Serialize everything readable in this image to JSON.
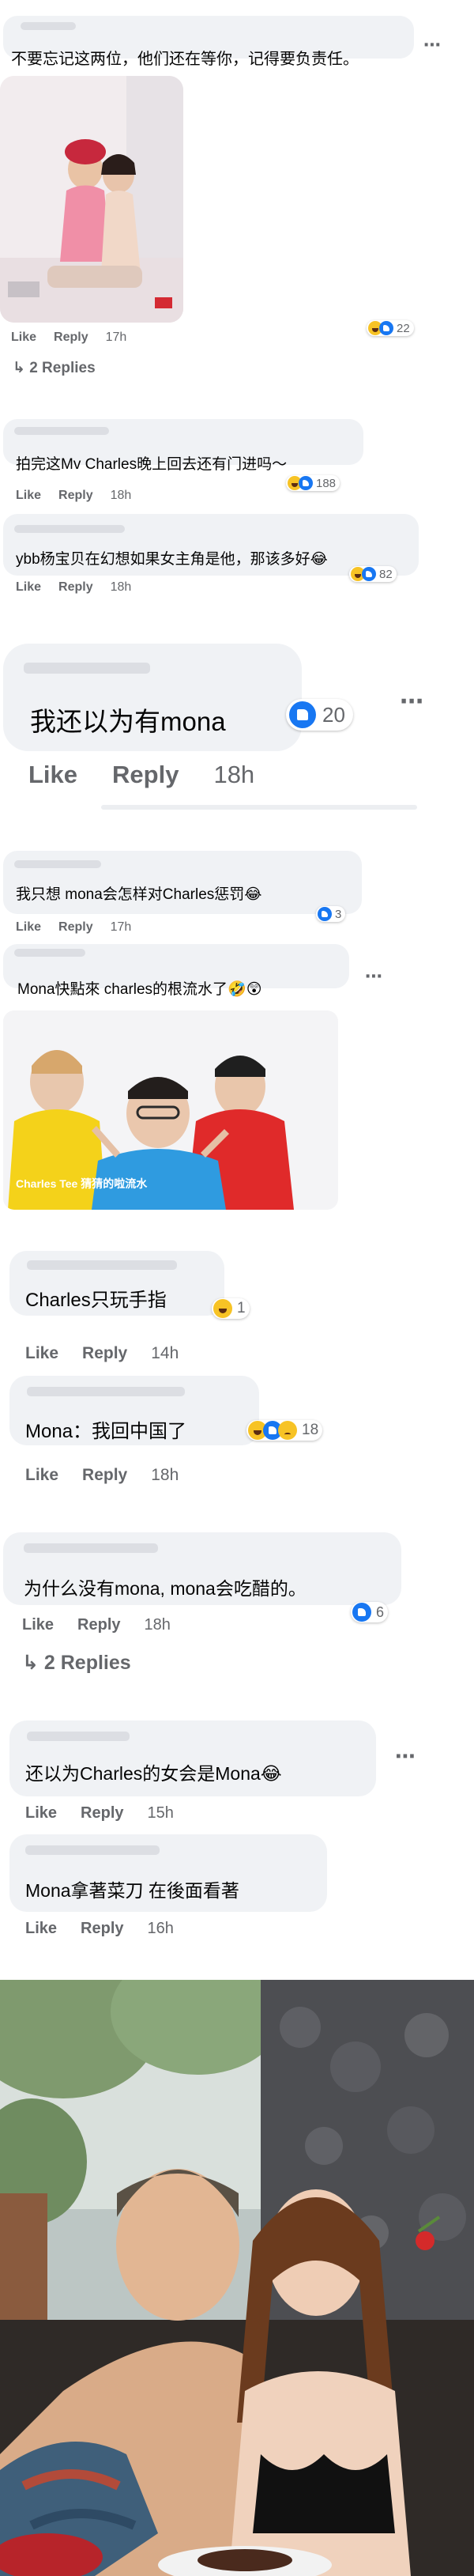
{
  "actions": {
    "like": "Like",
    "reply": "Reply"
  },
  "more_icon": "⋯",
  "replies_arrow": "↳",
  "comments": [
    {
      "text": "不要忘记这两位，他们还在等你，记得要负责任。",
      "time": "17h",
      "reactions": "22",
      "replies": "2 Replies"
    },
    {
      "text": "拍完这Mv Charles晚上回去还有门进吗～",
      "time": "18h",
      "reactions": "188"
    },
    {
      "text": "ybb杨宝贝在幻想如果女主角是他，那该多好😂",
      "time": "18h",
      "reactions": "82"
    },
    {
      "text": "我还以为有mona",
      "time": "18h",
      "reactions": "20"
    },
    {
      "text": "我只想  mona会怎样对Charles惩罚😂",
      "time": "17h",
      "reactions": "3"
    },
    {
      "text": "Mona快點來 charles的根流水了🤣😲",
      "image_caption": "Charles Tee 猜猜的啦流水"
    },
    {
      "text": "Charles只玩手指",
      "time": "14h",
      "reactions": "1"
    },
    {
      "text": "Mona：我回中国了",
      "time": "18h",
      "reactions": "18"
    },
    {
      "text": "为什么没有mona, mona会吃醋的。",
      "time": "18h",
      "reactions": "6",
      "replies": "2 Replies"
    },
    {
      "text": "还以为Charles的女会是Mona😂",
      "time": "15h"
    },
    {
      "text": "Mona拿著菜刀 在後面看著",
      "time": "16h"
    }
  ],
  "colors": {
    "bubble": "#f0f2f5",
    "meta": "#65676b",
    "like": "#1877f2",
    "haha": "#f7c325"
  }
}
